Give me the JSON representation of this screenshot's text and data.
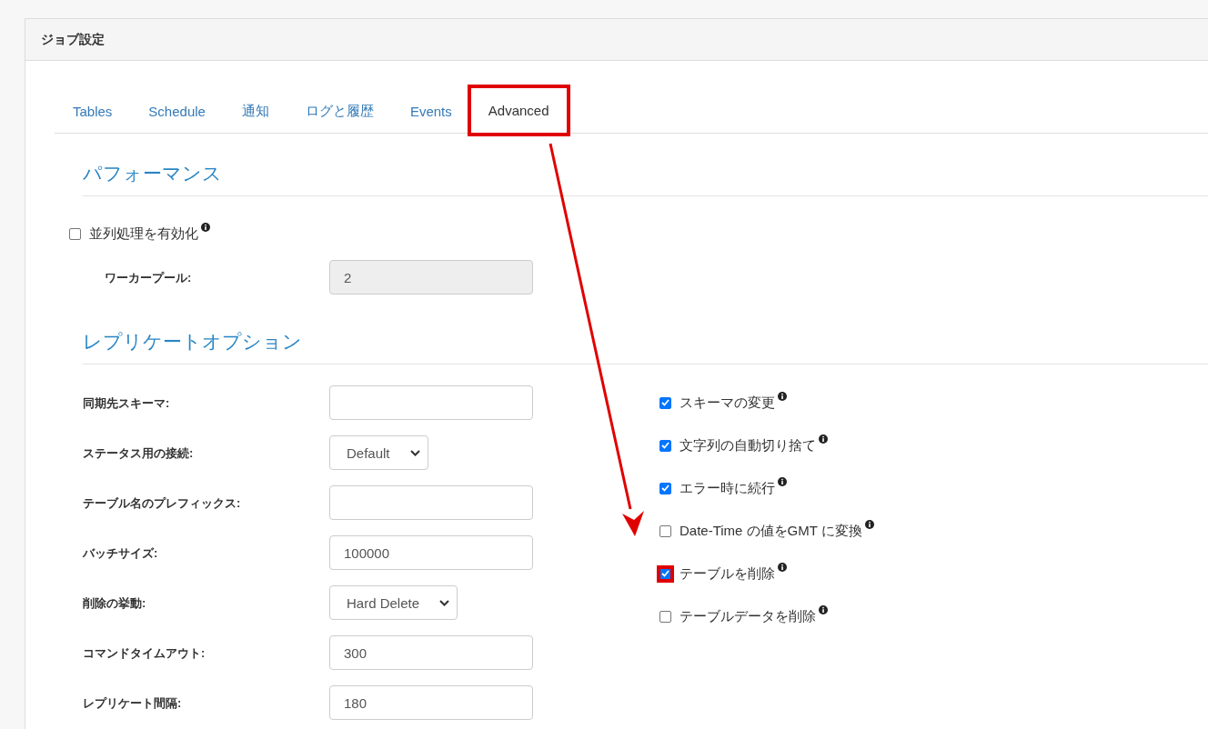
{
  "panel": {
    "title": "ジョブ設定"
  },
  "tabs": [
    {
      "label": "Tables",
      "selected": false,
      "highlighted": false
    },
    {
      "label": "Schedule",
      "selected": false,
      "highlighted": false
    },
    {
      "label": "通知",
      "selected": false,
      "highlighted": false
    },
    {
      "label": "ログと履歴",
      "selected": false,
      "highlighted": false
    },
    {
      "label": "Events",
      "selected": false,
      "highlighted": false
    },
    {
      "label": "Advanced",
      "selected": true,
      "highlighted": true
    }
  ],
  "performance": {
    "heading": "パフォーマンス",
    "parallel": {
      "label": "並列処理を有効化",
      "checked": false
    },
    "worker_pool": {
      "label": "ワーカープール:",
      "value": "2",
      "disabled": true
    }
  },
  "replicate": {
    "heading": "レプリケートオプション",
    "fields": [
      {
        "label": "同期先スキーマ:",
        "kind": "text"
      },
      {
        "label": "ステータス用の接続:",
        "kind": "select",
        "value": "Default"
      },
      {
        "label": "テーブル名のプレフィックス:",
        "kind": "text"
      },
      {
        "label": "バッチサイズ:",
        "kind": "text",
        "value": "100000"
      },
      {
        "label": "削除の挙動:",
        "kind": "select",
        "value": "Hard Delete"
      },
      {
        "label": "コマンドタイムアウト:",
        "kind": "text",
        "value": "300"
      },
      {
        "label": "レプリケート間隔:",
        "kind": "text",
        "value": "180"
      }
    ],
    "options": [
      {
        "label": "スキーマの変更",
        "checked": true,
        "highlighted": false
      },
      {
        "label": "文字列の自動切り捨て",
        "checked": true,
        "highlighted": false
      },
      {
        "label": "エラー時に続行",
        "checked": true,
        "highlighted": false
      },
      {
        "label": "Date-Time の値をGMT に変換",
        "checked": false,
        "highlighted": false
      },
      {
        "label": "テーブルを削除",
        "checked": true,
        "highlighted": true
      },
      {
        "label": "テーブルデータを削除",
        "checked": false,
        "highlighted": false
      }
    ]
  }
}
